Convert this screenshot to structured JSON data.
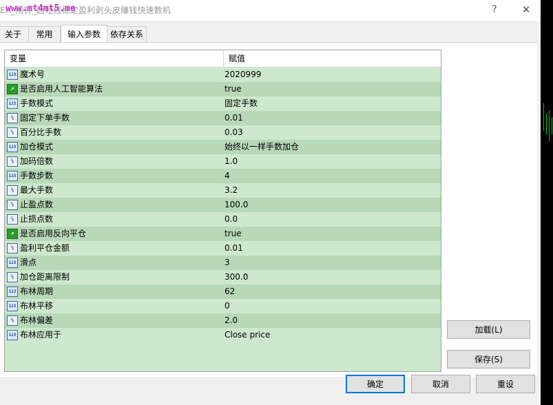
{
  "window": {
    "title": "EA_闹钟_超短线稳定盈利剥头皮赚钱快速数机",
    "watermark": "www.mt4mt5.me",
    "help_label": "?",
    "close_label": "✕"
  },
  "tabs": [
    {
      "label": "关于",
      "active": false
    },
    {
      "label": "常用",
      "active": false
    },
    {
      "label": "输入参数",
      "active": true
    },
    {
      "label": "依存关系",
      "active": false
    }
  ],
  "grid": {
    "headers": {
      "variable": "变量",
      "value": "赋值"
    },
    "rows": [
      {
        "type": "int",
        "icon": "int-icon",
        "name": "魔术号",
        "value": "2020999"
      },
      {
        "type": "bool",
        "icon": "bool-icon",
        "name": "是否启用人工智能算法",
        "value": "true"
      },
      {
        "type": "int",
        "icon": "int-icon",
        "name": "手数模式",
        "value": "固定手数"
      },
      {
        "type": "double",
        "icon": "double-icon",
        "name": "固定下单手数",
        "value": "0.01"
      },
      {
        "type": "double",
        "icon": "double-icon",
        "name": "百分比手数",
        "value": "0.03"
      },
      {
        "type": "int",
        "icon": "int-icon",
        "name": "加仓模式",
        "value": "始终以一样手数加仓"
      },
      {
        "type": "double",
        "icon": "double-icon",
        "name": "加码倍数",
        "value": "1.0"
      },
      {
        "type": "int",
        "icon": "int-icon",
        "name": "手数步数",
        "value": "4"
      },
      {
        "type": "double",
        "icon": "double-icon",
        "name": "最大手数",
        "value": "3.2"
      },
      {
        "type": "double",
        "icon": "double-icon",
        "name": "止盈点数",
        "value": "100.0"
      },
      {
        "type": "double",
        "icon": "double-icon",
        "name": "止损点数",
        "value": "0.0"
      },
      {
        "type": "bool",
        "icon": "bool-icon",
        "name": "是否启用反向平仓",
        "value": "true"
      },
      {
        "type": "double",
        "icon": "double-icon",
        "name": "盈利平仓金额",
        "value": "0.01"
      },
      {
        "type": "int",
        "icon": "int-icon",
        "name": "滑点",
        "value": "3"
      },
      {
        "type": "double",
        "icon": "double-icon",
        "name": "加仓距离限制",
        "value": "300.0"
      },
      {
        "type": "int",
        "icon": "int-icon",
        "name": "布林周期",
        "value": "62"
      },
      {
        "type": "int",
        "icon": "int-icon",
        "name": "布林平移",
        "value": "0"
      },
      {
        "type": "double",
        "icon": "double-icon",
        "name": "布林偏差",
        "value": "2.0"
      },
      {
        "type": "int",
        "icon": "int-icon",
        "name": "布林应用于",
        "value": "Close price"
      }
    ]
  },
  "side_buttons": {
    "load": "加载(L)",
    "save": "保存(S)"
  },
  "footer_buttons": {
    "ok": "确定",
    "cancel": "取消",
    "reset": "重设"
  },
  "icon_glyphs": {
    "int": "123",
    "double": "½",
    "bool": "↗"
  },
  "colors": {
    "row_light": "#cde8cd",
    "row_dark": "#b8d8b8",
    "accent": "#0078d7",
    "watermark": "#cc33cc"
  }
}
